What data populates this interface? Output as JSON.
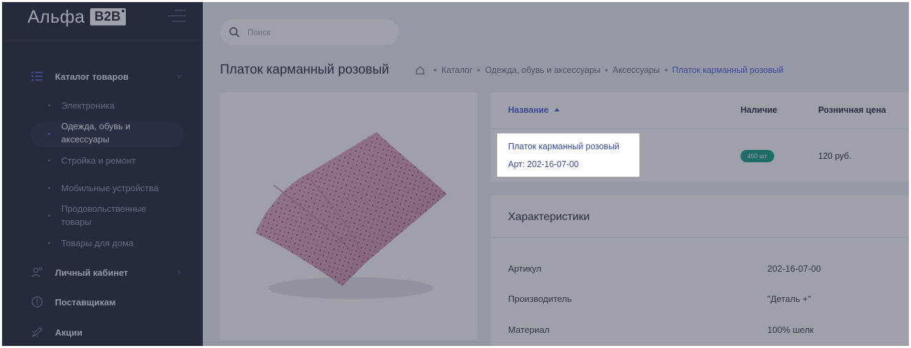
{
  "app": {
    "logo_text": "Альфа",
    "logo_badge": "B2B"
  },
  "search": {
    "placeholder": "Поиск"
  },
  "sidebar": {
    "catalog": {
      "label": "Каталог товаров",
      "icon": "list-icon",
      "items": [
        {
          "label": "Электроника"
        },
        {
          "label": "Одежда, обувь и аксессуары",
          "active": true
        },
        {
          "label": "Стройка и ремонт"
        },
        {
          "label": "Мобильные устройства"
        },
        {
          "label": "Продовольственные товары"
        },
        {
          "label": "Товары для дома"
        }
      ]
    },
    "account": {
      "label": "Личный кабинет",
      "icon": "user-settings-icon"
    },
    "suppliers": {
      "label": "Поставщикам",
      "icon": "info-circle-icon"
    },
    "promos": {
      "label": "Акции",
      "icon": "rocket-icon"
    }
  },
  "page": {
    "title": "Платок карманный розовый",
    "breadcrumb": [
      "Каталог",
      "Одежда, обувь и аксессуары",
      "Аксессуары",
      "Платок карманный розовый"
    ]
  },
  "table": {
    "headers": {
      "name": "Название",
      "stock": "Наличие",
      "price": "Розничная цена"
    },
    "row": {
      "name": "Платок карманный розовый",
      "article": "Арт: 202-16-07-00",
      "stock": "450 шт",
      "price": "120 руб."
    }
  },
  "characteristics": {
    "title": "Характеристики",
    "rows": [
      {
        "key": "Артикул",
        "value": "202-16-07-00"
      },
      {
        "key": "Производитель",
        "value": "\"Деталь +\""
      },
      {
        "key": "Материал",
        "value": "100% шелк"
      }
    ]
  },
  "colors": {
    "sidebar_bg": "#23283a",
    "accent": "#4a5fd8",
    "stock_badge": "#16a085",
    "product_pink": "#e8a7bc"
  }
}
